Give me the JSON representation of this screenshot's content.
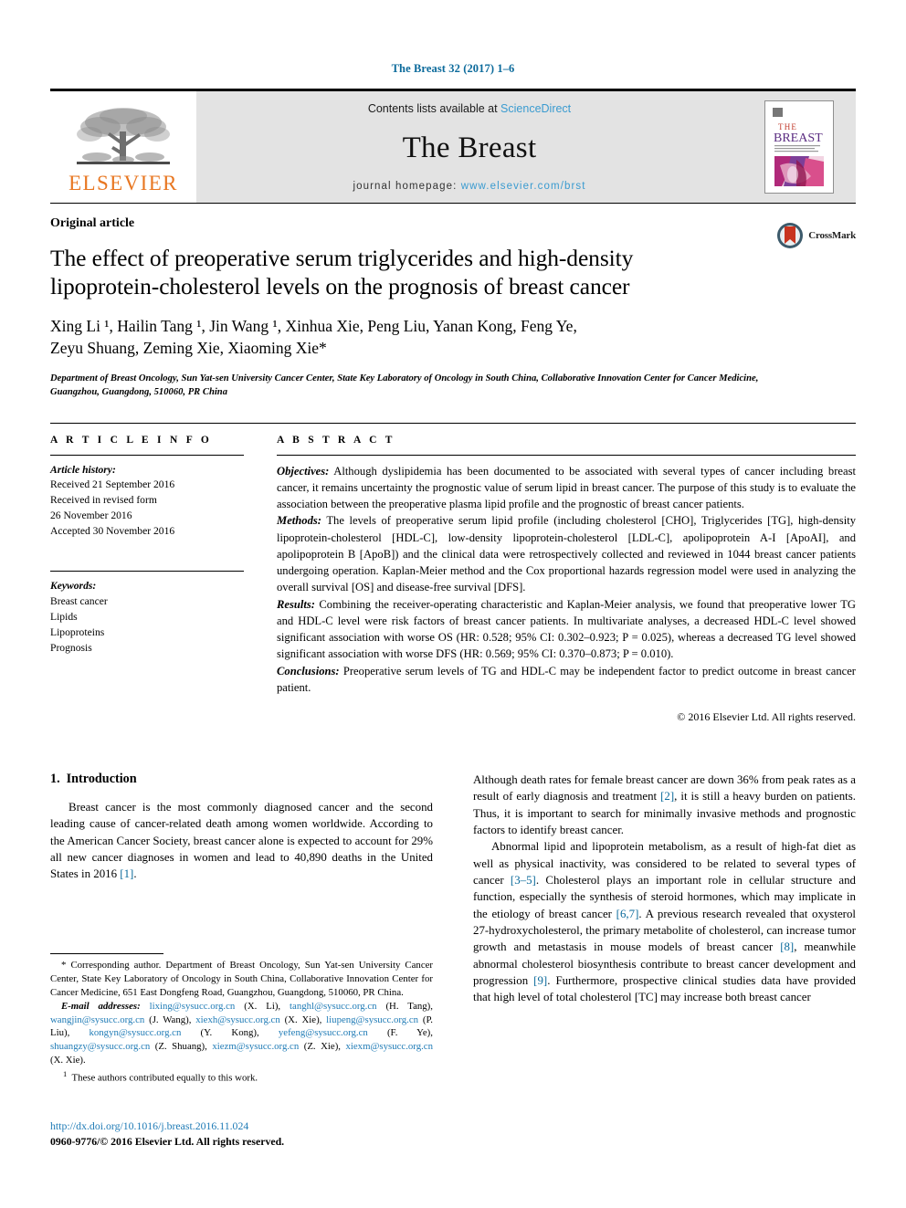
{
  "running_head": "The Breast 32 (2017) 1–6",
  "masthead": {
    "publisher_name": "ELSEVIER",
    "contents_prefix": "Contents lists available at ",
    "sciencedirect": "ScienceDirect",
    "journal_title": "The Breast",
    "homepage_prefix": "journal homepage: ",
    "homepage_url": "www.elsevier.com/brst",
    "cover_title_the": "THE",
    "cover_title_breast": "BREAST"
  },
  "article": {
    "type": "Original article",
    "title": "The effect of preoperative serum triglycerides and high-density lipoprotein-cholesterol levels on the prognosis of breast cancer",
    "authors_line1": "Xing Li ¹, Hailin Tang ¹, Jin Wang ¹, Xinhua Xie, Peng Liu, Yanan Kong, Feng Ye,",
    "authors_line2": "Zeyu Shuang, Zeming Xie, Xiaoming Xie*",
    "affiliation": "Department of Breast Oncology, Sun Yat-sen University Cancer Center, State Key Laboratory of Oncology in South China, Collaborative Innovation Center for Cancer Medicine, Guangzhou, Guangdong, 510060, PR China",
    "crossmark_label": "CrossMark"
  },
  "article_info": {
    "heading": "A R T I C L E   I N F O",
    "history_label": "Article history:",
    "history": [
      "Received 21 September 2016",
      "Received in revised form",
      "26 November 2016",
      "Accepted 30 November 2016"
    ],
    "keywords_label": "Keywords:",
    "keywords": [
      "Breast cancer",
      "Lipids",
      "Lipoproteins",
      "Prognosis"
    ]
  },
  "abstract": {
    "heading": "A B S T R A C T",
    "sections": [
      {
        "label": "Objectives:",
        "text": " Although dyslipidemia has been documented to be associated with several types of cancer including breast cancer, it remains uncertainty the prognostic value of serum lipid in breast cancer. The purpose of this study is to evaluate the association between the preoperative plasma lipid profile and the prognostic of breast cancer patients."
      },
      {
        "label": "Methods:",
        "text": " The levels of preoperative serum lipid profile (including cholesterol [CHO], Triglycerides [TG], high-density lipoprotein-cholesterol [HDL-C], low-density lipoprotein-cholesterol [LDL-C], apolipoprotein A-I [ApoAI], and apolipoprotein B [ApoB]) and the clinical data were retrospectively collected and reviewed in 1044 breast cancer patients undergoing operation. Kaplan-Meier method and the Cox proportional hazards regression model were used in analyzing the overall survival [OS] and disease-free survival [DFS]."
      },
      {
        "label": "Results:",
        "text": " Combining the receiver-operating characteristic and Kaplan-Meier analysis, we found that preoperative lower TG and HDL-C level were risk factors of breast cancer patients. In multivariate analyses, a decreased HDL-C level showed significant association with worse OS (HR: 0.528; 95% CI: 0.302–0.923; P = 0.025), whereas a decreased TG level showed significant association with worse DFS (HR: 0.569; 95% CI: 0.370–0.873; P = 0.010)."
      },
      {
        "label": "Conclusions:",
        "text": " Preoperative serum levels of TG and HDL-C may be independent factor to predict outcome in breast cancer patient."
      }
    ],
    "copyright": "© 2016 Elsevier Ltd. All rights reserved."
  },
  "introduction": {
    "number": "1.",
    "heading": "Introduction",
    "left_paragraphs": [
      "Breast cancer is the most commonly diagnosed cancer and the second leading cause of cancer-related death among women worldwide. According to the American Cancer Society, breast cancer alone is expected to account for 29% all new cancer diagnoses in women and lead to 40,890 deaths in the United States in 2016 [1]."
    ],
    "right_paragraphs": [
      "Although death rates for female breast cancer are down 36% from peak rates as a result of early diagnosis and treatment [2], it is still a heavy burden on patients. Thus, it is important to search for minimally invasive methods and prognostic factors to identify breast cancer.",
      "Abnormal lipid and lipoprotein metabolism, as a result of high-fat diet as well as physical inactivity, was considered to be related to several types of cancer [3–5]. Cholesterol plays an important role in cellular structure and function, especially the synthesis of steroid hormones, which may implicate in the etiology of breast cancer [6,7]. A previous research revealed that oxysterol 27-hydroxycholesterol, the primary metabolite of cholesterol, can increase tumor growth and metastasis in mouse models of breast cancer [8], meanwhile abnormal cholesterol biosynthesis contribute to breast cancer development and progression [9]. Furthermore, prospective clinical studies data have provided that high level of total cholesterol [TC] may increase both breast cancer"
    ]
  },
  "footnotes": {
    "corresponding": "* Corresponding author. Department of Breast Oncology, Sun Yat-sen University Cancer Center, State Key Laboratory of Oncology in South China, Collaborative Innovation Center for Cancer Medicine, 651 East Dongfeng Road, Guangzhou, Guangdong, 510060, PR China.",
    "email_label": "E-mail addresses:",
    "emails": [
      {
        "address": "lixing@sysucc.org.cn",
        "person": " (X. Li), "
      },
      {
        "address": "tanghl@sysucc.org.cn",
        "person": " (H. Tang), "
      },
      {
        "address": "wangjin@sysucc.org.cn",
        "person": " (J. Wang), "
      },
      {
        "address": "xiexh@sysucc.org.cn",
        "person": " (X. Xie), "
      },
      {
        "address": "liupeng@sysucc.org.cn",
        "person": " (P. Liu), "
      },
      {
        "address": "kongyn@sysucc.org.cn",
        "person": " (Y. Kong), "
      },
      {
        "address": "yefeng@sysucc.org.cn",
        "person": " (F. Ye), "
      },
      {
        "address": "shuangzy@sysucc.org.cn",
        "person": " (Z. Shuang), "
      },
      {
        "address": "xiezm@sysucc.org.cn",
        "person": " (Z. Xie), "
      },
      {
        "address": "xiexm@sysucc.org.cn",
        "person": " (X. Xie)."
      }
    ],
    "equal_contribution": "These authors contributed equally to this work."
  },
  "footer": {
    "doi": "http://dx.doi.org/10.1016/j.breast.2016.11.024",
    "issn_copyright": "0960-9776/© 2016 Elsevier Ltd. All rights reserved."
  },
  "colors": {
    "link_blue": "#1f7bb6",
    "header_blue": "#0b6a9b",
    "sciencedirect_blue": "#3a9bd0",
    "elsevier_orange": "#e87722",
    "masthead_gray": "#e3e3e3",
    "crossmark_red": "#c8341f"
  }
}
